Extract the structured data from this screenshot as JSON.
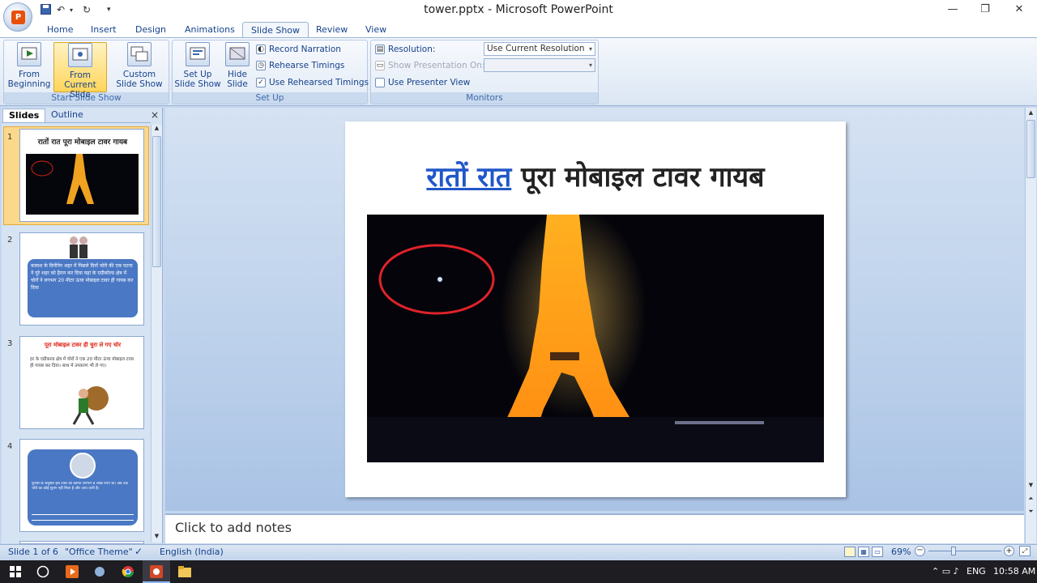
{
  "window": {
    "title": "tower.pptx - Microsoft PowerPoint",
    "minimize": "—",
    "restore": "❐",
    "close": "✕"
  },
  "qat": {
    "undo": "↶",
    "redo": "↻",
    "customize": "▾"
  },
  "tabs": [
    "Home",
    "Insert",
    "Design",
    "Animations",
    "Slide Show",
    "Review",
    "View"
  ],
  "active_tab": "Slide Show",
  "ribbon": {
    "start_group": {
      "label": "Start Slide Show",
      "from_beginning": "From Beginning",
      "from_current": "From Current Slide",
      "custom": "Custom Slide Show"
    },
    "setup_group": {
      "label": "Set Up",
      "setup_show": "Set Up Slide Show",
      "hide_slide": "Hide Slide",
      "record_narration": "Record Narration",
      "rehearse_timings": "Rehearse Timings",
      "use_rehearsed": "Use Rehearsed Timings",
      "use_rehearsed_checked": true
    },
    "monitors_group": {
      "label": "Monitors",
      "resolution_label": "Resolution:",
      "resolution_value": "Use Current Resolution",
      "show_on_label": "Show Presentation On:",
      "show_on_value": "",
      "presenter_view": "Use Presenter View",
      "presenter_view_checked": false
    }
  },
  "pane": {
    "tabs": [
      "Slides",
      "Outline"
    ],
    "close": "×",
    "slides": [
      {
        "num": "1",
        "title": "रातों रात पूरा मोबाइल टावर गायब",
        "selected": true
      },
      {
        "num": "2",
        "text": "कलाश के विनीपेग शहर में पिछले दिनों चोरी की एक घटना ने पूरे शहर को हैरान कर दिया यहां के एग्रीकोल्ड क्षेत्र में चोरों ने लगभग 20 मीटर ऊंचा मोबाइल टावर ही गायब कर दिया"
      },
      {
        "num": "3",
        "title": "पूरा मोबाइल टावर ही चुरा ले गए चोर",
        "text": "हर के एग्रीकल्ड क्षेत्र में चोरों ने एक 20 मीटर ऊंचा मोबाइल टावर ही गायब कर दिया। साथ में उपकरण भी ले गए।"
      },
      {
        "num": "4",
        "text": "पुलिस के अनुसार इस टावर की कीमत लगभग 8 लाख रुपए थी। अब तक चोरों का कोई सुराग नहीं मिला है और जांच जारी है।"
      }
    ]
  },
  "slide": {
    "title_underlined": "रातों रात",
    "title_rest": " पूरा मोबाइल टावर गायब"
  },
  "notes_placeholder": "Click to add notes",
  "status": {
    "slide_of": "Slide 1 of 6",
    "theme": "\"Office Theme\"",
    "language": "English (India)",
    "zoom": "69%"
  },
  "taskbar": {
    "lang": "ENG",
    "time": "10:58 AM"
  }
}
